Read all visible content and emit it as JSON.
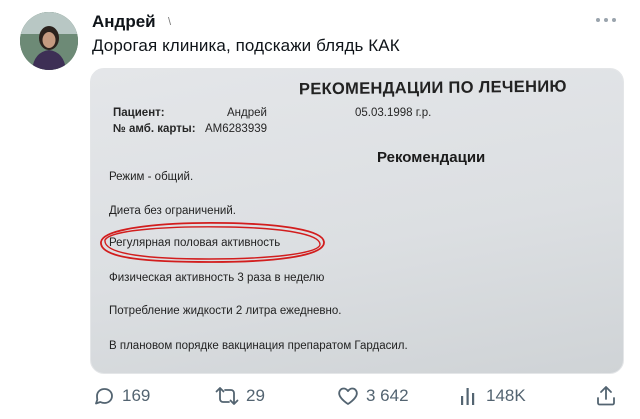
{
  "tweet": {
    "author": "Андрей",
    "author_mark": "\\",
    "text": "Дорогая клиника, подскажи блядь КАК"
  },
  "document": {
    "title": "РЕКОМЕНДАЦИИ ПО ЛЕЧЕНИЮ",
    "patient_label": "Пациент:",
    "patient_name": "Андрей",
    "birthdate": "05.03.1998 г.р.",
    "card_label": "№ амб. карты:",
    "card_number": "АМ6283939",
    "rec_heading": "Рекомендации",
    "items": [
      "Режим - общий.",
      "Диета без ограничений.",
      "Регулярная половая активность",
      "Физическая активность 3 раза в неделю",
      "Потребление жидкости 2 литра ежедневно.",
      "В плановом порядке вакцинация препаратом Гардасил."
    ],
    "highlight_color": "#d21d1d"
  },
  "actions": {
    "replies": "169",
    "retweets": "29",
    "likes": "3 642",
    "views": "148K"
  },
  "icons": [
    "more-icon",
    "reply-icon",
    "retweet-icon",
    "like-icon",
    "views-icon",
    "share-icon"
  ],
  "colors": {
    "text": "#0f1419",
    "muted": "#536471"
  }
}
